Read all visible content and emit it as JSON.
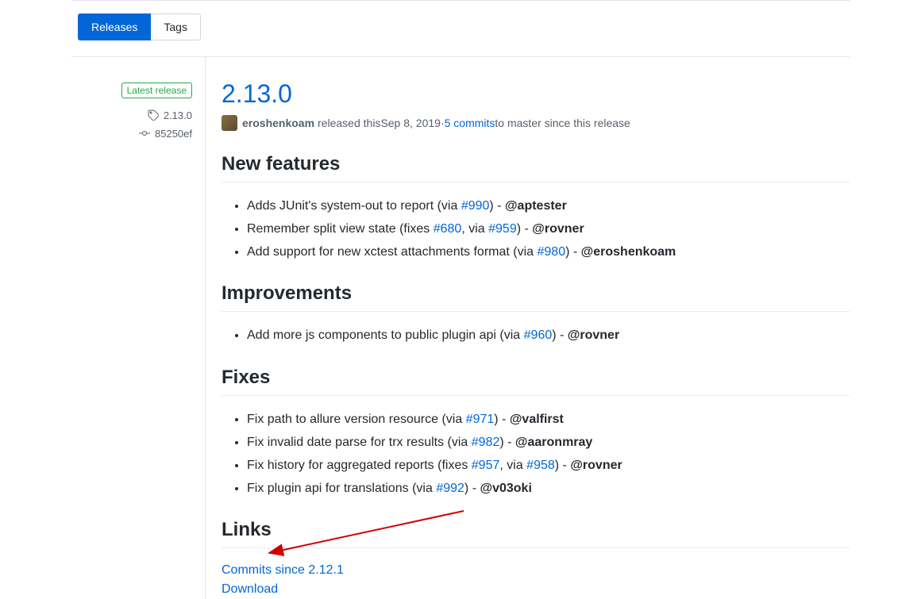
{
  "tabs": {
    "releases": "Releases",
    "tags": "Tags"
  },
  "sidebar": {
    "latest_badge": "Latest release",
    "tag_name": "2.13.0",
    "commit_sha": "85250ef"
  },
  "release": {
    "title": "2.13.0",
    "author": "eroshenkoam",
    "released_text": " released this ",
    "date": "Sep 8, 2019",
    "commits_link": "5 commits",
    "commits_suffix": " to master since this release",
    "separator": " · "
  },
  "sections": {
    "new_features": {
      "heading": "New features",
      "items": [
        {
          "pre": "Adds JUnit's system-out to report (via ",
          "pr": "#990",
          "mid": ") - ",
          "mention": "@aptester"
        },
        {
          "pre": "Remember split view state (fixes ",
          "pr": "#680",
          "mid": ", via ",
          "pr2": "#959",
          "post": ") - ",
          "mention": "@rovner"
        },
        {
          "pre": "Add support for new xctest attachments format (via ",
          "pr": "#980",
          "mid": ") - ",
          "mention": "@eroshenkoam"
        }
      ]
    },
    "improvements": {
      "heading": "Improvements",
      "items": [
        {
          "pre": "Add more js components to public plugin api (via ",
          "pr": "#960",
          "mid": ") - ",
          "mention": "@rovner"
        }
      ]
    },
    "fixes": {
      "heading": "Fixes",
      "items": [
        {
          "pre": "Fix path to allure version resource (via ",
          "pr": "#971",
          "mid": ") - ",
          "mention": "@valfirst"
        },
        {
          "pre": "Fix invalid date parse for trx results (via ",
          "pr": "#982",
          "mid": ") - ",
          "mention": "@aaronmray"
        },
        {
          "pre": "Fix history for aggregated reports (fixes ",
          "pr": "#957",
          "mid": ", via ",
          "pr2": "#958",
          "post": ") - ",
          "mention": "@rovner"
        },
        {
          "pre": "Fix plugin api for translations (via ",
          "pr": "#992",
          "mid": ") - ",
          "mention": "@v03oki"
        }
      ]
    },
    "links": {
      "heading": "Links",
      "commits_since": "Commits since 2.12.1",
      "download": "Download"
    }
  }
}
